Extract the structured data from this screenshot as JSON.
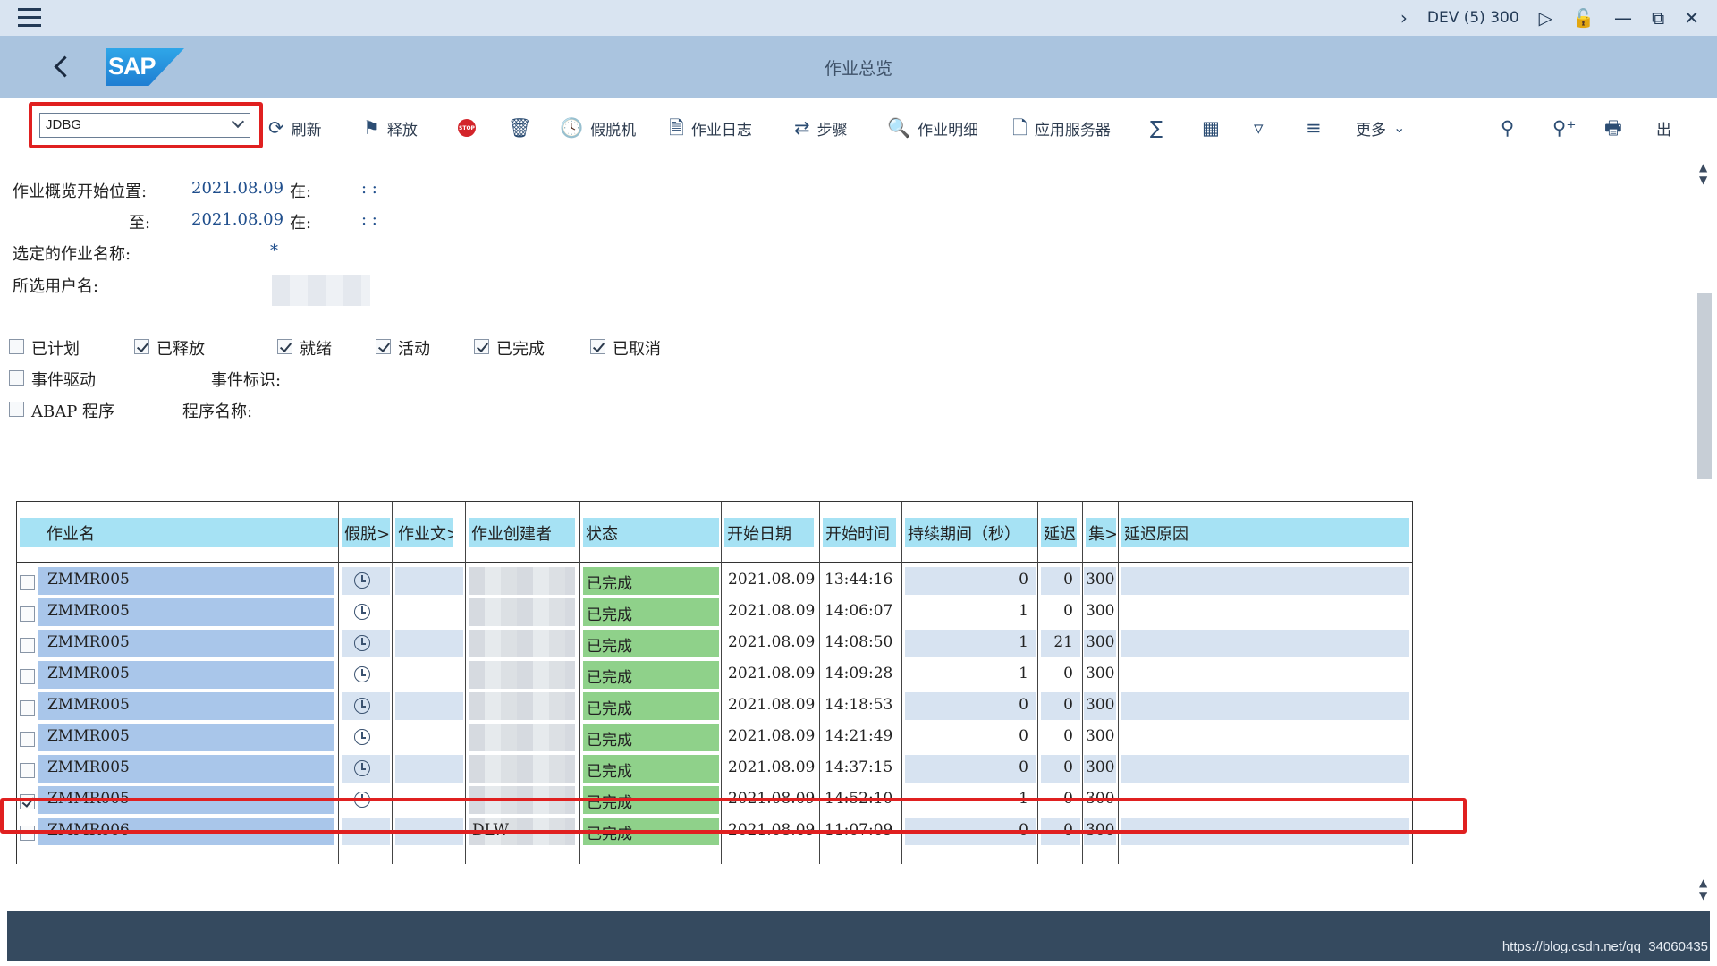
{
  "titlebar": {
    "system": "DEV (5) 300",
    "icons": [
      "menu-icon",
      "chevron-right-icon",
      "play-icon",
      "unlock-icon",
      "minimize-icon",
      "restore-icon",
      "close-icon"
    ]
  },
  "header": {
    "title": "作业总览",
    "logo": "SAP"
  },
  "toolbar": {
    "variant": "JDBG",
    "buttons": {
      "refresh": "刷新",
      "release": "释放",
      "stop": "STOP",
      "offline": "假脱机",
      "job_log": "作业日志",
      "step": "步骤",
      "job_details": "作业明细",
      "app_server": "应用服务器",
      "more": "更多",
      "exit": "出"
    }
  },
  "criteria": {
    "from_label": "作业概览开始位置:",
    "from_date": "2021.08.09",
    "at_label": "在:",
    "from_time": ":  :",
    "to_label": "至:",
    "to_date": "2021.08.09",
    "to_time": ":  :",
    "jobname_label": "选定的作业名称:",
    "jobname_value": "*",
    "user_label": "所选用户名:"
  },
  "status_filters": [
    {
      "label": "已计划",
      "checked": false
    },
    {
      "label": "已释放",
      "checked": true
    },
    {
      "label": "就绪",
      "checked": true
    },
    {
      "label": "活动",
      "checked": true
    },
    {
      "label": "已完成",
      "checked": true
    },
    {
      "label": "已取消",
      "checked": true
    }
  ],
  "event_driven": {
    "label": "事件驱动",
    "checked": false,
    "id_label": "事件标识:"
  },
  "abap_program": {
    "label": "ABAP 程序",
    "checked": false,
    "name_label": "程序名称:"
  },
  "table": {
    "columns": [
      "作业名",
      "假脱>",
      "作业文>",
      "作业创建者",
      "状态",
      "开始日期",
      "开始时间",
      "持续期间（秒）",
      "延迟",
      "集>",
      "延迟原因"
    ],
    "rows": [
      {
        "name": "ZMMR005",
        "spool": true,
        "creator": "",
        "status": "已完成",
        "date": "2021.08.09",
        "time": "13:44:16",
        "duration": "0",
        "delay": "0",
        "client": "300",
        "checked": false
      },
      {
        "name": "ZMMR005",
        "spool": true,
        "creator": "",
        "status": "已完成",
        "date": "2021.08.09",
        "time": "14:06:07",
        "duration": "1",
        "delay": "0",
        "client": "300",
        "checked": false
      },
      {
        "name": "ZMMR005",
        "spool": true,
        "creator": "",
        "status": "已完成",
        "date": "2021.08.09",
        "time": "14:08:50",
        "duration": "1",
        "delay": "21",
        "client": "300",
        "checked": false
      },
      {
        "name": "ZMMR005",
        "spool": true,
        "creator": "",
        "status": "已完成",
        "date": "2021.08.09",
        "time": "14:09:28",
        "duration": "1",
        "delay": "0",
        "client": "300",
        "checked": false
      },
      {
        "name": "ZMMR005",
        "spool": true,
        "creator": "",
        "status": "已完成",
        "date": "2021.08.09",
        "time": "14:18:53",
        "duration": "0",
        "delay": "0",
        "client": "300",
        "checked": false
      },
      {
        "name": "ZMMR005",
        "spool": true,
        "creator": "",
        "status": "已完成",
        "date": "2021.08.09",
        "time": "14:21:49",
        "duration": "0",
        "delay": "0",
        "client": "300",
        "checked": false
      },
      {
        "name": "ZMMR005",
        "spool": true,
        "creator": "",
        "status": "已完成",
        "date": "2021.08.09",
        "time": "14:37:15",
        "duration": "0",
        "delay": "0",
        "client": "300",
        "checked": false
      },
      {
        "name": "ZMMR005",
        "spool": true,
        "creator": "",
        "status": "已完成",
        "date": "2021.08.09",
        "time": "14:52:10",
        "duration": "1",
        "delay": "0",
        "client": "300",
        "checked": true
      },
      {
        "name": "ZMMR006",
        "spool": false,
        "creator": "DLW",
        "status": "已完成",
        "date": "2021.08.09",
        "time": "11:07:09",
        "duration": "0",
        "delay": "0",
        "client": "300",
        "checked": false
      }
    ]
  },
  "watermark": "https://blog.csdn.net/qq_34060435",
  "colors": {
    "header_bg": "#aac4df",
    "titlebar_bg": "#d9e4f1",
    "column_header": "#a6e2f4",
    "name_cell": "#a9c6ea",
    "status_done": "#8fd18a",
    "highlight": "#e02020",
    "statusbar": "#354a5f"
  }
}
